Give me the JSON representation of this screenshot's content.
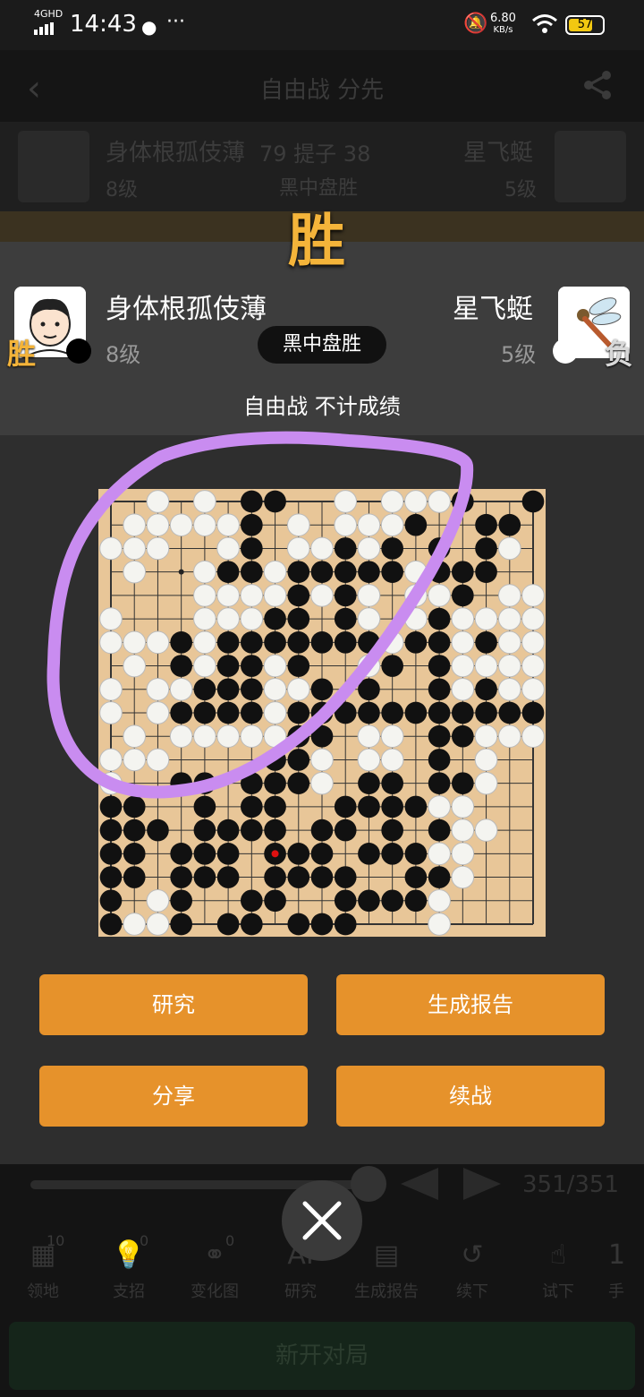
{
  "status_bar": {
    "time": "14:43",
    "network": "4GHD",
    "speed_value": "6.80",
    "speed_unit": "KB/s",
    "battery": "57"
  },
  "background": {
    "title": "自由战 分先",
    "black_player": "身体根孤伎薄",
    "white_player": "星飞蜓",
    "captures_label": "79 提子 38",
    "result": "黑中盘胜",
    "black_rank": "8级",
    "white_rank": "5级",
    "move_counter": "351/351",
    "tools": [
      {
        "label": "领地",
        "badge": "10"
      },
      {
        "label": "支招",
        "badge": "0"
      },
      {
        "label": "变化图",
        "badge": "0"
      },
      {
        "label": "研究",
        "badge": ""
      },
      {
        "label": "生成报告",
        "badge": ""
      },
      {
        "label": "续下",
        "badge": ""
      },
      {
        "label": "试下",
        "badge": ""
      },
      {
        "label": "手",
        "badge": ""
      }
    ],
    "new_game": "新开对局"
  },
  "modal": {
    "win_badge": "胜",
    "black": {
      "name": "身体根孤伎薄",
      "rank": "8级",
      "tag": "胜"
    },
    "white": {
      "name": "星飞蜓",
      "rank": "5级",
      "tag": "负"
    },
    "result_pill": "黑中盘胜",
    "subtitle": "自由战 不计成绩",
    "buttons": {
      "study": "研究",
      "report": "生成报告",
      "share": "分享",
      "continue": "续战"
    }
  },
  "board": {
    "size": 19,
    "rows": [
      "..W.W.BB..W.WWWB..B",
      ".WWWWWB.W.WWWB..BB.",
      "WWW..WB.WWBWB.B.BW.",
      ".W..WBBWBBBBBWBBB..",
      "....WWWWBWBW.WWB.WW",
      "W...WWWBB.BW.WBWWWW",
      "WWWBWBBBBBBBWBBWBWW",
      ".W.BWBBWB..WB.BWWWW",
      "W.WWBBBWWB.B..BWBWW",
      "W.WBBBBWBBBBBBBBBBB",
      ".W.WWWWWBB.WW.BBWWWW",
      "WWW....BBW.WW.B.W..",
      "W..BB.BBBW.BB.BBW..",
      "BB..B.BB..BBBBWW...",
      "BBB.BBBB.BB.B.BWW..",
      "BB.BBB.RBB.BBBWW...",
      "BB.BBB.BBBB..BBW...",
      "B.WB..BB..BBBBW....",
      "BWWB.BB.BBB...W...."
    ]
  },
  "colors": {
    "accent": "#e6922b",
    "win": "#f4b43a",
    "board": "#e8c698",
    "annotation": "#c98cf0"
  },
  "icons": {
    "close": "close-icon",
    "back": "back-arrow-icon",
    "share": "share-icon"
  }
}
